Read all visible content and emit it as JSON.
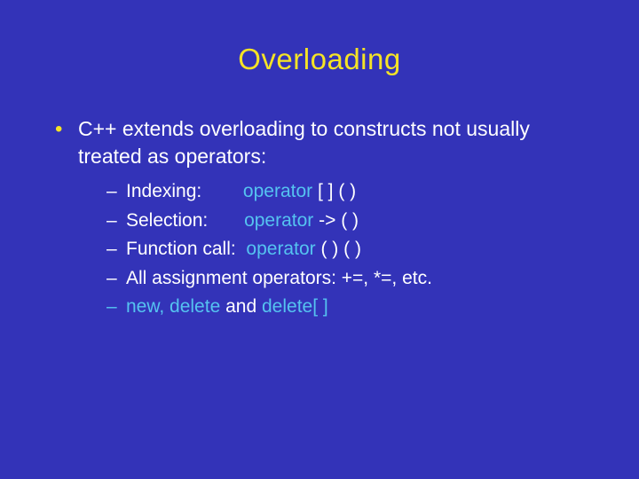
{
  "title": "Overloading",
  "bullet": {
    "text_a": "C++ extends overloading to constructs not usually",
    "text_b": "treated as operators:"
  },
  "sub": [
    {
      "label": "Indexing:",
      "kw": "operator",
      "sig": " [ ] ( )",
      "dash": "–"
    },
    {
      "label": "Selection:",
      "kw": "operator",
      "sig": " -> ( )",
      "dash": "–"
    },
    {
      "label": "Function call:",
      "kw": "operator",
      "sig": " ( ) ( )",
      "dash": "–"
    },
    {
      "label": "All assignment operators: +=, *=, etc.",
      "kw": "",
      "sig": "",
      "dash": "–"
    }
  ],
  "sub5": {
    "dash": "–",
    "a": "new, delete",
    "b": " and ",
    "c": "delete[ ]"
  }
}
